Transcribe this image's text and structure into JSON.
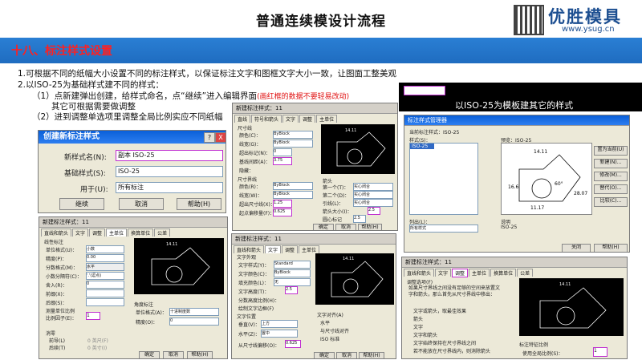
{
  "header": {
    "title": "普通连续模设计流程",
    "logo_text": "优胜模具",
    "logo_url": "www.ysug.cn"
  },
  "section": {
    "title": "十八、标注样式设置"
  },
  "body": {
    "line1": "1.可根据不同的纸幅大小设置不同的标注样式，以保证标注文字和图框文字大小一致，让图面工整美观",
    "line2": "2.以ISO-25为基础样式建不同的样式：",
    "line3a": "（1）点新建弹出创建，给样式命名，点“继续”进入编辑界面",
    "line3b": "(画红框的数据不要轻易改动)",
    "line4": "其它可根据需要做调整",
    "line5": "（2）进到调整单选项里调整全局比例实应不同纸幅"
  },
  "create_dialog": {
    "title": "创建新标注样式",
    "help": "?",
    "close": "X",
    "name_label": "新样式名(N):",
    "name_value": "副本 ISO-25",
    "base_label": "基础样式(S):",
    "base_value": "ISO-25",
    "use_label": "用于(U):",
    "use_value": "所有标注",
    "continue": "继续",
    "cancel": "取消",
    "help_btn": "帮助(H)"
  },
  "manager": {
    "caption": "以ISO-25为模板建其它的样式",
    "title": "标注样式管理器",
    "current_label": "当前标注样式：ISO-25",
    "styles_label": "样式(S)：",
    "style_item": "ISO-25",
    "preview_label": "预览：ISO-25",
    "list_label": "列出(L)：",
    "list_value": "所有样式",
    "desc_label": "说明",
    "desc_value": "ISO-25",
    "buttons": [
      "置为当前(U)",
      "新建(N)...",
      "修改(M)...",
      "替代(O)...",
      "比较(C)..."
    ],
    "bottom": [
      "关闭",
      "帮助(H)"
    ]
  },
  "modify_lines": {
    "title": "新建标注样式：11",
    "tabs": [
      "直线",
      "符号和箭头",
      "文字",
      "调整",
      "主单位",
      "换算单位",
      "公差"
    ],
    "group1": "尺寸线",
    "rows1": [
      "颜色(C)：",
      "线宽(G)：",
      "超出标记(N)：",
      "基线间距(A)：",
      "隐藏："
    ],
    "vals1": [
      "ByBlock",
      "ByBlock",
      "0",
      "3.75"
    ],
    "group2": "尺寸界线",
    "rows2": [
      "颜色(R)：",
      "线宽(W)：",
      "超出尺寸线(X)：",
      "起点偏移量(F)："
    ],
    "vals2": [
      "ByBlock",
      "ByBlock",
      "1.25",
      "0.625"
    ],
    "arrow_group": "箭头",
    "arrow_rows": [
      "第一个(T)：",
      "第二个(D)：",
      "引线(L)：",
      "箭头大小(I)："
    ],
    "arrow_vals": [
      "实心闭合",
      "实心闭合",
      "实心闭合",
      "2.5"
    ],
    "center_label": "圆心标记",
    "center_val": "2.5",
    "ok": "确定",
    "cancel": "取消",
    "help": "帮助(H)"
  },
  "modify_units": {
    "title": "新建标注样式：11",
    "tabs": [
      "直线和箭头",
      "文字",
      "调整",
      "主单位",
      "换算单位",
      "公差"
    ],
    "group": "线性标注",
    "rows": [
      "单位格式(U)：",
      "精度(P)：",
      "分数格式(M)：",
      "小数分隔符(C)：",
      "舍入(R)：",
      "前缀(X)：",
      "后缀(S)："
    ],
    "vals": [
      "小数",
      "0.00",
      "水平",
      "'.'(逗点)",
      "0"
    ],
    "scale_group": "测量单位比例",
    "scale_label": "比例因子(E)：",
    "scale_value": "1",
    "angle_group": "角度标注",
    "angle_rows": [
      "单位格式(A)：",
      "精度(O)："
    ],
    "angle_vals": [
      "十进制度数",
      "0"
    ],
    "zero_group": "消零",
    "zero_opts": [
      "前导(L)",
      "后续(T)",
      "0 英尺(F)",
      "0 英寸(I)"
    ],
    "ok": "确定",
    "cancel": "取消",
    "help": "帮助(H)"
  },
  "modify_text": {
    "title": "新建标注样式：11",
    "tabs": [
      "直线和箭头",
      "文字",
      "调整",
      "主单位",
      "换算单位",
      "公差"
    ],
    "group": "文字外观",
    "rows": [
      "文字样式(Y)：",
      "文字颜色(C)：",
      "填充颜色(L)：",
      "文字高度(T)：",
      "分数高度比例(H)："
    ],
    "vals": [
      "Standard",
      "ByBlock",
      "无",
      "2.5"
    ],
    "frame_opt": "绘制文字边框(F)",
    "pos_group": "文字位置",
    "pos_rows": [
      "垂直(V)：",
      "水平(Z)：",
      "从尺寸线偏移(O)："
    ],
    "pos_vals": [
      "上方",
      "置中",
      "0.625"
    ],
    "align_group": "文字对齐(A)",
    "align_opts": [
      "水平",
      "与尺寸线对齐",
      "ISO 标准"
    ],
    "ok": "确定",
    "cancel": "取消",
    "help": "帮助(H)"
  },
  "modify_fit": {
    "title": "新建标注样式：11",
    "tabs": [
      "直线和箭头",
      "文字",
      "调整",
      "主单位",
      "换算单位",
      "公差"
    ],
    "group": "调整选项(F)",
    "desc": "如果尺寸界线之间没有足够的空间来放置文字和箭头，那么首先从尺寸界线中移出：",
    "opts": [
      "文字或箭头，取最佳效果",
      "箭头",
      "文字",
      "文字和箭头",
      "文字始终保持在尺寸界线之间",
      "若不能放在尺寸界线内，则消除箭头"
    ],
    "scale_group": "标注特征比例",
    "scale_opt": "使用全局比例(S)：",
    "scale_value": "1"
  },
  "preview_dims": [
    "14.11",
    "16.6",
    "28.07",
    "11.17",
    "60°",
    "R11.17"
  ]
}
